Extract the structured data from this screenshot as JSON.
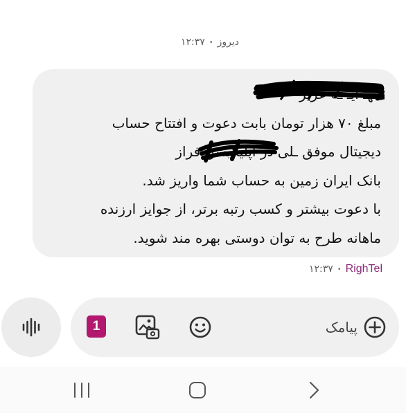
{
  "conversation": {
    "top_timestamp": "۱۲:۳۷",
    "top_day": "دیروز",
    "message": {
      "lines": [
        "مهـ          آیـ     ـه عزیز",
        "مبلغ ۷۰ هزار تومان بابت دعوت و افتتاح حساب",
        "دیجیتال موفق        ـلی در اپلیکیشن فراز",
        "بانک ایران زمین به حساب شما واریز شد.",
        "با دعوت بیشتر و کسب رتبه برتر، از جوایز ارزنده",
        "ماهانه طرح به توان دوستی بهره مند شوید."
      ],
      "sender": "RighTel",
      "time": "۱۲:۳۷"
    }
  },
  "composer": {
    "sim_label": "1",
    "placeholder": "پیامک"
  },
  "icons": {
    "voice": "voice-waveform-icon",
    "attach": "gallery-attach-icon",
    "emoji": "smiley-icon",
    "add": "add-circle-icon",
    "nav_recents": "recents-icon",
    "nav_home": "home-icon",
    "nav_back": "back-chevron-icon"
  },
  "colors": {
    "bubble": "#f0f0f0",
    "sender": "#8a2a78",
    "sim_badge": "#b2186e"
  }
}
